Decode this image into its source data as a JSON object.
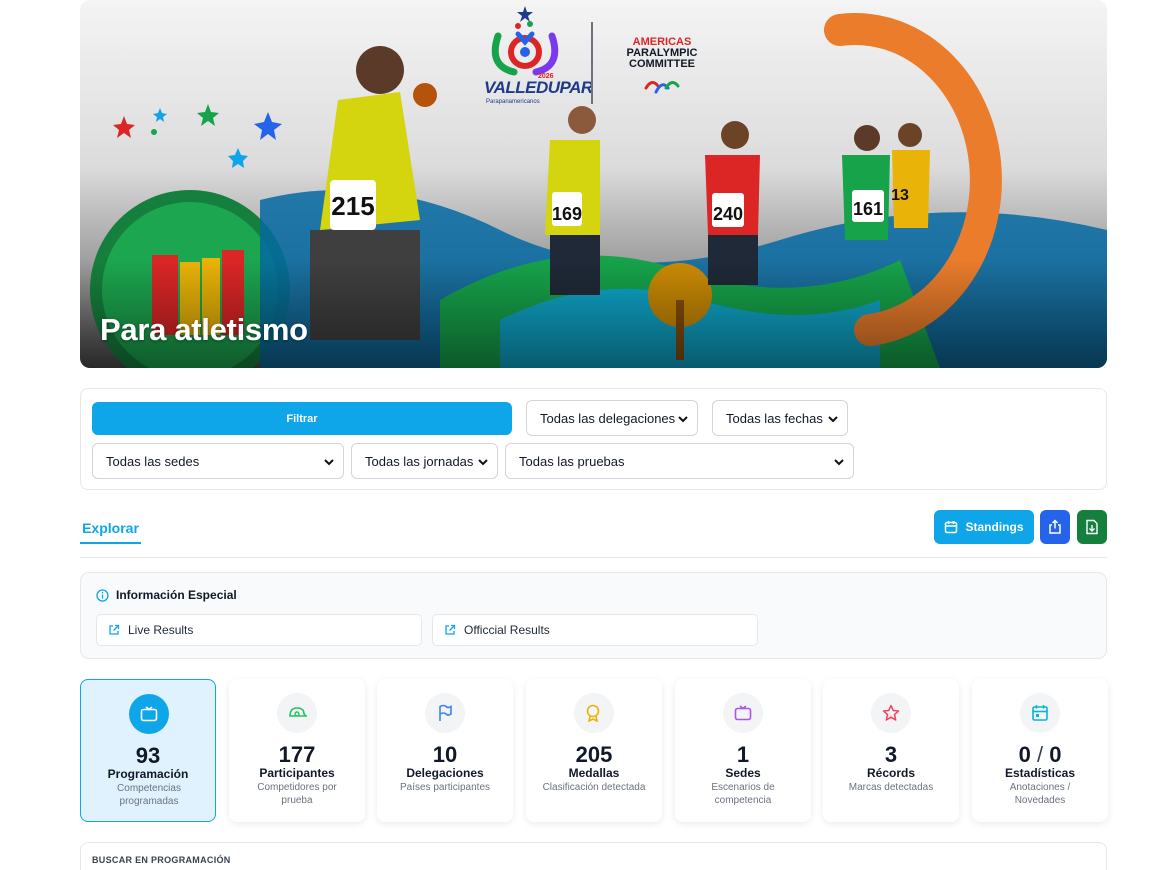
{
  "hero": {
    "title": "Para atletismo",
    "logo_valledupar": "VALLEDUPAR",
    "logo_year": "2026",
    "logo_sub": "Parapanamericanos",
    "apc_line1": "AMERICAS",
    "apc_line2": "PARALYMPIC",
    "apc_line3": "COMMITTEE"
  },
  "filters": {
    "filter_button": "Filtrar",
    "delegations": "Todas las delegaciones",
    "dates": "Todas las fechas",
    "venues": "Todas las sedes",
    "sessions": "Todas las jornadas",
    "events": "Todas las pruebas"
  },
  "tabs": {
    "explore": "Explorar"
  },
  "actions": {
    "standings": "Standings"
  },
  "info": {
    "title": "Información Especial",
    "links": [
      {
        "label": "Live Results"
      },
      {
        "label": "Officcial Results"
      }
    ]
  },
  "stats": [
    {
      "value": "93",
      "label": "Programación",
      "sub": "Competencias programadas",
      "icon": "tv-icon",
      "color": "#0ea5e9"
    },
    {
      "value": "177",
      "label": "Participantes",
      "sub": "Competidores por prueba",
      "icon": "helmet-icon",
      "color": "#22c55e"
    },
    {
      "value": "10",
      "label": "Delegaciones",
      "sub": "Países participantes",
      "icon": "flag-icon",
      "color": "#3b82f6"
    },
    {
      "value": "205",
      "label": "Medallas",
      "sub": "Clasificación detectada",
      "icon": "medal-icon",
      "color": "#eab308"
    },
    {
      "value": "1",
      "label": "Sedes",
      "sub": "Escenarios de competencia",
      "icon": "venue-icon",
      "color": "#a855f7"
    },
    {
      "value": "3",
      "label": "Récords",
      "sub": "Marcas detectadas",
      "icon": "star-icon",
      "color": "#f43f5e"
    },
    {
      "value_a": "0",
      "value_sep": "/",
      "value_b": "0",
      "label": "Estadísticas",
      "sub": "Anotaciones / Novedades",
      "icon": "calendar-icon",
      "color": "#06b6d4"
    }
  ],
  "search": {
    "label": "BUSCAR EN PROGRAMACIÓN"
  },
  "athletes": {
    "bib_215": "215",
    "bib_169": "169",
    "bib_240": "240",
    "bib_161": "161",
    "bib_13": "13"
  }
}
